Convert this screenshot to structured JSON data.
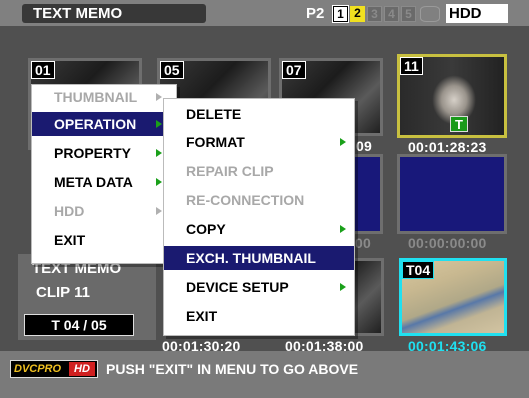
{
  "header": {
    "title": "TEXT MEMO",
    "media_label": "P2",
    "slots": [
      "1",
      "2",
      "3",
      "4",
      "5"
    ],
    "hdd_label": "HDD"
  },
  "thumbnails": [
    {
      "number": "01"
    },
    {
      "number": "05"
    },
    {
      "number": "07",
      "timecode": "09"
    },
    {
      "number": "11",
      "timecode": "00:01:28:23",
      "badge": "T"
    },
    {
      "timecode": "00"
    },
    {
      "timecode": "00:00:00:00"
    },
    {
      "timecode": "00:01:30:20"
    },
    {
      "timecode": "00:01:38:00"
    },
    {
      "number": "T04",
      "timecode": "00:01:43:06"
    }
  ],
  "info": {
    "title": "TEXT MEMO",
    "clip": "CLIP 11",
    "count": "T 04  /  05"
  },
  "status": {
    "logo_a": "DVCPRO",
    "logo_b": "HD",
    "message": "PUSH \"EXIT\" IN MENU TO GO ABOVE"
  },
  "menu_main": [
    {
      "label": "THUMBNAIL",
      "state": "disabled",
      "submenu": true
    },
    {
      "label": "OPERATION",
      "state": "selected",
      "submenu": true
    },
    {
      "label": "PROPERTY",
      "state": "normal",
      "submenu": true
    },
    {
      "label": "META DATA",
      "state": "normal",
      "submenu": true
    },
    {
      "label": "HDD",
      "state": "disabled",
      "submenu": true
    },
    {
      "label": "EXIT",
      "state": "normal",
      "submenu": false
    }
  ],
  "menu_operation": [
    {
      "label": "DELETE",
      "state": "normal",
      "submenu": false
    },
    {
      "label": "FORMAT",
      "state": "normal",
      "submenu": true
    },
    {
      "label": "REPAIR CLIP",
      "state": "disabled",
      "submenu": false
    },
    {
      "label": "RE-CONNECTION",
      "state": "disabled",
      "submenu": false
    },
    {
      "label": "COPY",
      "state": "normal",
      "submenu": true
    },
    {
      "label": "EXCH. THUMBNAIL",
      "state": "selected",
      "submenu": false
    },
    {
      "label": "DEVICE SETUP",
      "state": "normal",
      "submenu": true
    },
    {
      "label": "EXIT",
      "state": "normal",
      "submenu": false
    }
  ],
  "colors": {
    "selected_bg": "#1a1a70",
    "arrow": "#1aa01a",
    "tc_cyan": "#20e0f0",
    "focus_yellow": "#c8c040"
  }
}
